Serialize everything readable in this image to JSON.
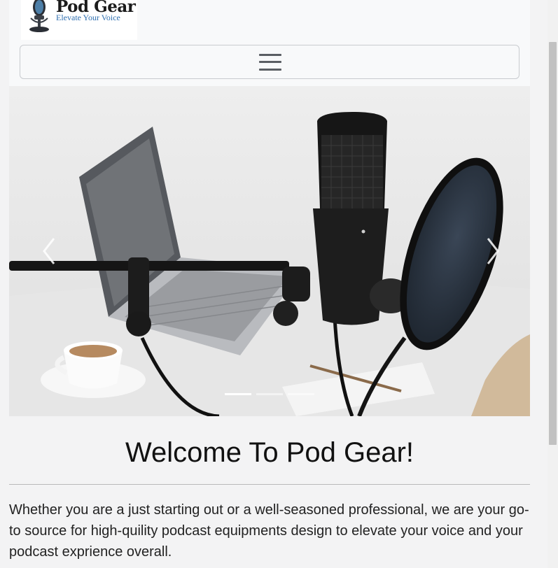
{
  "brand": {
    "name": "Pod Gear",
    "tagline": "Elevate Your Voice"
  },
  "carousel": {
    "slide_count": 3,
    "active_index": 0
  },
  "content": {
    "heading": "Welcome To Pod Gear!",
    "paragraph": "Whether you are a just starting out or a well-seasoned professional, we are your go-to source for high-quility podcast equipments design to elevate your voice and your podcast exprience overall."
  },
  "icons": {
    "menu": "hamburger-icon",
    "prev": "chevron-left-icon",
    "next": "chevron-right-icon",
    "logo": "microphone-icon"
  },
  "colors": {
    "tagline": "#2f6fb0",
    "page_bg": "#f3f3f4",
    "navbar_bg": "#f8f9fa"
  }
}
